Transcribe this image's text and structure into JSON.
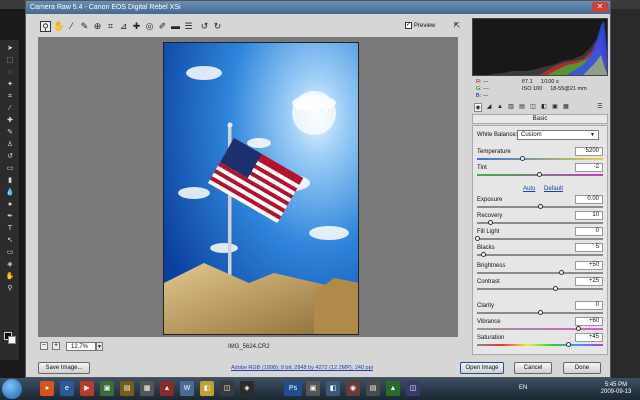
{
  "dialog": {
    "title": "Camera Raw 5.4  -  Canon EOS Digital Rebel XSi",
    "preview_label": "Preview",
    "preview_checked": true
  },
  "toolbar": {
    "tools": [
      "zoom-tool",
      "hand-tool",
      "white-balance-tool",
      "color-sampler-tool",
      "target-adjustment-tool",
      "crop-tool",
      "straighten-tool",
      "spot-removal-tool",
      "red-eye-removal-tool",
      "adjustment-brush-tool",
      "graduated-filter-tool",
      "preferences-tool",
      "rotate-ccw-tool",
      "rotate-cw-tool"
    ],
    "active_tool": "zoom-tool"
  },
  "canvas": {
    "zoom": "12.7%",
    "filename": "IMG_5624.CR2"
  },
  "readout": {
    "r_label": "R:",
    "g_label": "G:",
    "b_label": "B:",
    "r_value": "---",
    "g_value": "---",
    "b_value": "---",
    "aperture": "f/7.1",
    "shutter": "1/100 s",
    "iso": "ISO 100",
    "lens": "18-55@21 mm"
  },
  "panel": {
    "title": "Basic",
    "white_balance_label": "White Balance:",
    "white_balance_value": "Custom",
    "auto_label": "Auto",
    "default_label": "Default",
    "controls": [
      {
        "name": "temperature",
        "label": "Temperature",
        "value": "5200",
        "pos": 0.36
      },
      {
        "name": "tint",
        "label": "Tint",
        "value": "-2",
        "pos": 0.49
      },
      {
        "name": "exposure",
        "label": "Exposure",
        "value": "0.00",
        "pos": 0.5
      },
      {
        "name": "recovery",
        "label": "Recovery",
        "value": "10",
        "pos": 0.1
      },
      {
        "name": "fill-light",
        "label": "Fill Light",
        "value": "0",
        "pos": 0.0
      },
      {
        "name": "blacks",
        "label": "Blacks",
        "value": "5",
        "pos": 0.05
      },
      {
        "name": "brightness",
        "label": "Brightness",
        "value": "+50",
        "pos": 0.67
      },
      {
        "name": "contrast",
        "label": "Contrast",
        "value": "+25",
        "pos": 0.62
      },
      {
        "name": "clarity",
        "label": "Clarity",
        "value": "0",
        "pos": 0.5
      },
      {
        "name": "vibrance",
        "label": "Vibrance",
        "value": "+60",
        "pos": 0.8
      },
      {
        "name": "saturation",
        "label": "Saturation",
        "value": "+45",
        "pos": 0.72
      }
    ]
  },
  "buttons": {
    "save": "Save Image...",
    "open": "Open Image",
    "cancel": "Cancel",
    "done": "Done"
  },
  "workflow": "Adobe RGB (1998); 8 bit; 2848 by 4272 (12.2MP); 240 ppi",
  "taskbar": {
    "lang": "EN",
    "time": "5:45 PM",
    "date": "2009-09-13",
    "photoshop_label": "Ps"
  }
}
